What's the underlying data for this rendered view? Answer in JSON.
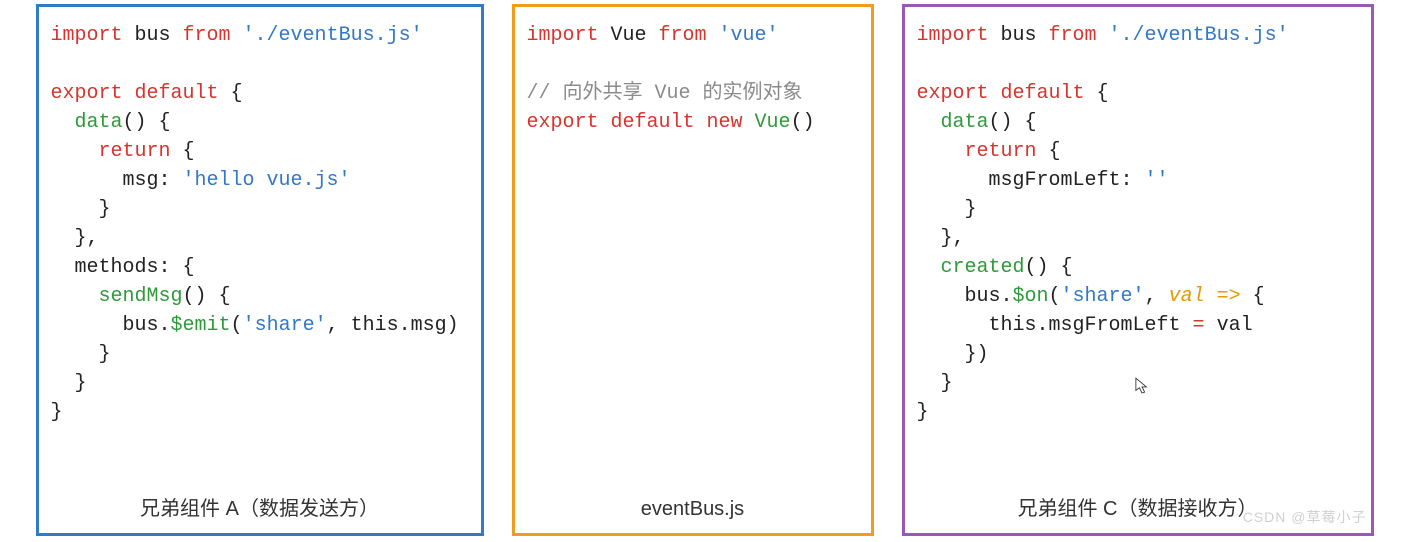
{
  "panels": {
    "left": {
      "caption": "兄弟组件 A（数据发送方）",
      "code": {
        "l1_import": "import",
        "l1_bus": " bus ",
        "l1_from": "from",
        "l1_path": " './eventBus.js'",
        "l3_export": "export",
        "l3_default": " default",
        "l3_brace": " {",
        "l4_data": "  data",
        "l4_rest": "() {",
        "l5_return": "    return",
        "l5_rest": " {",
        "l6_msg": "      msg: ",
        "l6_val": "'hello vue.js'",
        "l7": "    }",
        "l8": "  },",
        "l9": "  methods: {",
        "l10_send": "    sendMsg",
        "l10_rest": "() {",
        "l11_pre": "      bus.",
        "l11_emit": "$emit",
        "l11_open": "(",
        "l11_share": "'share'",
        "l11_rest": ", this.msg)",
        "l12": "    }",
        "l13": "  }",
        "l14": "}"
      }
    },
    "middle": {
      "caption": "eventBus.js",
      "code": {
        "l1_import": "import",
        "l1_vue": " Vue ",
        "l1_from": "from",
        "l1_path": " 'vue'",
        "l3_comment": "// 向外共享 Vue 的实例对象",
        "l4_export": "export",
        "l4_default": " default",
        "l4_new": " new",
        "l4_vue": " Vue",
        "l4_rest": "()"
      }
    },
    "right": {
      "caption": "兄弟组件 C（数据接收方）",
      "code": {
        "l1_import": "import",
        "l1_bus": " bus ",
        "l1_from": "from",
        "l1_path": " './eventBus.js'",
        "l3_export": "export",
        "l3_default": " default",
        "l3_brace": " {",
        "l4_data": "  data",
        "l4_rest": "() {",
        "l5_return": "    return",
        "l5_rest": " {",
        "l6_msg": "      msgFromLeft: ",
        "l6_val": "''",
        "l7": "    }",
        "l8": "  },",
        "l9_created": "  created",
        "l9_rest": "() {",
        "l10_pre": "    bus.",
        "l10_on": "$on",
        "l10_open": "(",
        "l10_share": "'share'",
        "l10_comma": ", ",
        "l10_val": "val",
        "l10_arrow": " =>",
        "l10_rest": " {",
        "l11_pre": "      this.msgFromLeft ",
        "l11_eq": "=",
        "l11_rest": " val",
        "l12": "    })",
        "l13": "  }",
        "l14": "}"
      }
    }
  },
  "watermark": "CSDN @草莓小子"
}
